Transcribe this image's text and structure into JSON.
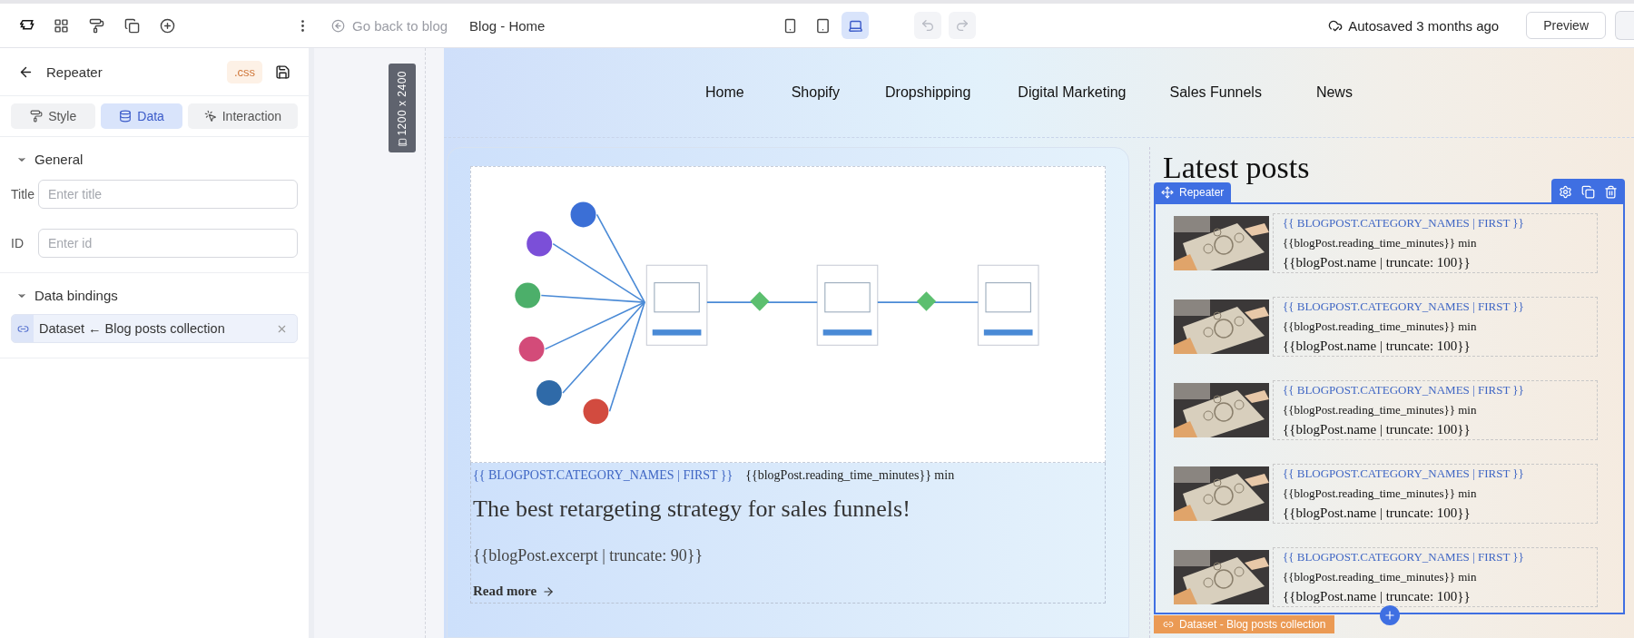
{
  "topbar": {
    "back_link": "Go back to blog",
    "page_title": "Blog - Home",
    "devices": [
      {
        "kind": "phone",
        "selected": false
      },
      {
        "kind": "tablet",
        "selected": false
      },
      {
        "kind": "laptop",
        "selected": true
      }
    ],
    "autosave": "Autosaved 3 months ago",
    "preview": "Preview"
  },
  "panel": {
    "title": "Repeater",
    "css_badge": ".css",
    "tabs": [
      {
        "label": "Style",
        "kind": "style",
        "selected": false
      },
      {
        "label": "Data",
        "kind": "data",
        "selected": true
      },
      {
        "label": "Interaction",
        "kind": "interaction",
        "selected": false
      }
    ],
    "sections": [
      {
        "title": "General",
        "expanded": true,
        "fields": [
          {
            "label": "Title",
            "placeholder": "Enter title"
          },
          {
            "label": "ID",
            "placeholder": "Enter id"
          }
        ]
      },
      {
        "title": "Data bindings",
        "expanded": true,
        "binding": "Dataset ← Blog posts collection"
      }
    ]
  },
  "canvas": {
    "size_label": "1200 x 2400",
    "nav": [
      "Home",
      "Shopify",
      "Dropshipping",
      "Digital Marketing",
      "Sales Funnels",
      "News"
    ],
    "featured": {
      "category": "{{ BLOGPOST.CATEGORY_NAMES | FIRST }}",
      "reading_time": "{{blogPost.reading_time_minutes}} min",
      "title": "The best retargeting strategy for sales funnels!",
      "excerpt": "{{blogPost.excerpt | truncate: 90}}",
      "read_more": "Read more"
    },
    "sidebar": {
      "heading": "Latest posts",
      "repeater_label": "Repeater",
      "items": [
        {
          "category": "{{ BLOGPOST.CATEGORY_NAMES | FIRST }}",
          "reading_time": "{{blogPost.reading_time_minutes}} min",
          "name": "{{blogPost.name | truncate: 100}}"
        },
        {
          "category": "{{ BLOGPOST.CATEGORY_NAMES | FIRST }}",
          "reading_time": "{{blogPost.reading_time_minutes}} min",
          "name": "{{blogPost.name | truncate: 100}}"
        },
        {
          "category": "{{ BLOGPOST.CATEGORY_NAMES | FIRST }}",
          "reading_time": "{{blogPost.reading_time_minutes}} min",
          "name": "{{blogPost.name | truncate: 100}}"
        },
        {
          "category": "{{ BLOGPOST.CATEGORY_NAMES | FIRST }}",
          "reading_time": "{{blogPost.reading_time_minutes}} min",
          "name": "{{blogPost.name | truncate: 100}}"
        },
        {
          "category": "{{ BLOGPOST.CATEGORY_NAMES | FIRST }}",
          "reading_time": "{{blogPost.reading_time_minutes}} min",
          "name": "{{blogPost.name | truncate: 100}}"
        }
      ],
      "dataset_label": "Dataset - Blog posts collection"
    }
  }
}
